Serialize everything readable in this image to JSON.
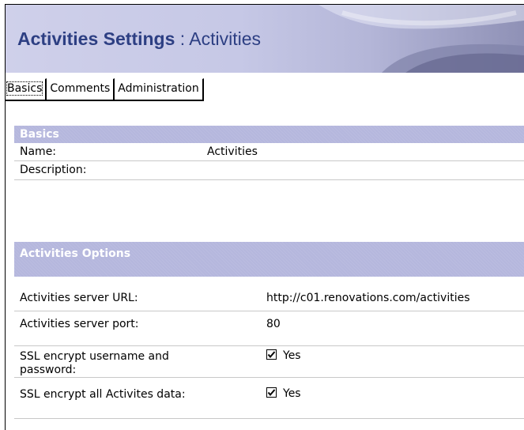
{
  "banner": {
    "title": "Activities Settings",
    "separator": " : ",
    "subtitle": "Activities"
  },
  "tabs": [
    {
      "label": "Basics",
      "active": true
    },
    {
      "label": "Comments",
      "active": false
    },
    {
      "label": "Administration",
      "active": false
    }
  ],
  "basics": {
    "heading": "Basics",
    "name_label": "Name:",
    "name_value": "Activities",
    "description_label": "Description:",
    "description_value": ""
  },
  "options": {
    "heading": "Activities Options",
    "server_url_label": "Activities server URL:",
    "server_url_value": "http://c01.renovations.com/activities",
    "server_port_label": "Activities server port:",
    "server_port_value": "80",
    "ssl_credentials_label": "SSL encrypt username and password:",
    "ssl_credentials_checked": true,
    "ssl_credentials_value": "Yes",
    "ssl_all_label": "SSL encrypt all Activites data:",
    "ssl_all_checked": true,
    "ssl_all_value": "Yes"
  },
  "colors": {
    "title": "#2d3f83",
    "section_header": "#b5b7dd"
  }
}
